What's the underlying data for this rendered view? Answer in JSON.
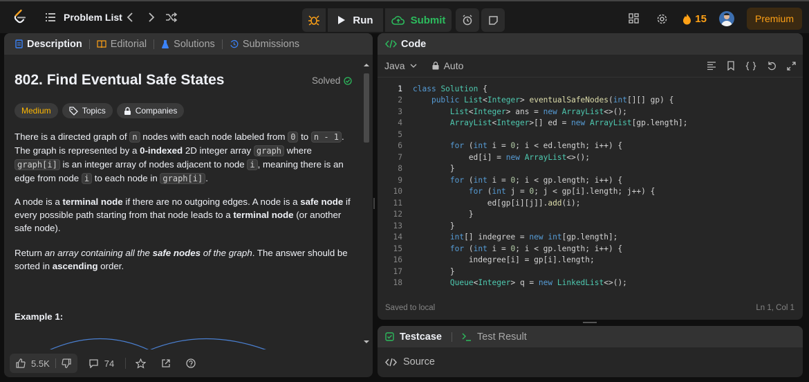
{
  "nav": {
    "problem_list": "Problem List"
  },
  "actions": {
    "run": "Run",
    "submit": "Submit"
  },
  "user": {
    "streak": "15",
    "premium": "Premium"
  },
  "left_tabs": [
    {
      "label": "Description"
    },
    {
      "label": "Editorial"
    },
    {
      "label": "Solutions"
    },
    {
      "label": "Submissions"
    }
  ],
  "problem": {
    "title": "802. Find Eventual Safe States",
    "status": "Solved",
    "difficulty": "Medium",
    "topics": "Topics",
    "companies": "Companies",
    "example_heading": "Example 1:"
  },
  "description": {
    "p1": {
      "t1": "There is a directed graph of ",
      "c1": "n",
      "t2": " nodes with each node labeled from ",
      "c2": "0",
      "t3": " to ",
      "c3": "n - 1",
      "t4": ". The graph is represented by a ",
      "b1": "0-indexed",
      "t5": " 2D integer array ",
      "c4": "graph",
      "t6": " where ",
      "c5": "graph[i]",
      "t7": " is an integer array of nodes adjacent to node ",
      "c6": "i",
      "t8": ", meaning there is an edge from node ",
      "c7": "i",
      "t9": " to each node in ",
      "c8": "graph[i]",
      "t10": "."
    },
    "p2": {
      "t1": "A node is a ",
      "b1": "terminal node",
      "t2": " if there are no outgoing edges. A node is a ",
      "b2": "safe node",
      "t3": " if every possible path starting from that node leads to a ",
      "b3": "terminal node",
      "t4": " (or another safe node)."
    },
    "p3": {
      "t1": "Return ",
      "i1": "an array containing all the ",
      "bi": "safe nodes",
      "i2": " of the graph",
      "t2": ". The answer should be sorted in ",
      "b1": "ascending",
      "t3": " order."
    }
  },
  "footer": {
    "likes": "5.5K",
    "comments": "74"
  },
  "code_panel": {
    "tab": "Code",
    "language": "Java",
    "mode": "Auto",
    "saved": "Saved to local",
    "cursor": "Ln 1, Col 1"
  },
  "code_lines": [
    {
      "n": "1"
    },
    {
      "n": "2"
    },
    {
      "n": "3"
    },
    {
      "n": "4"
    },
    {
      "n": "5"
    },
    {
      "n": "6"
    },
    {
      "n": "7"
    },
    {
      "n": "8"
    },
    {
      "n": "9"
    },
    {
      "n": "10"
    },
    {
      "n": "11"
    },
    {
      "n": "12"
    },
    {
      "n": "13"
    },
    {
      "n": "14"
    },
    {
      "n": "15"
    },
    {
      "n": "16"
    },
    {
      "n": "17"
    },
    {
      "n": "18"
    }
  ],
  "code_text": [
    "class Solution {",
    "    public List<Integer> eventualSafeNodes(int[][] gp) {",
    "        List<Integer> ans = new ArrayList<>();",
    "        ArrayList<Integer>[] ed = new ArrayList[gp.length];",
    "",
    "        for (int i = 0; i < ed.length; i++) {",
    "            ed[i] = new ArrayList<>();",
    "        }",
    "        for (int i = 0; i < gp.length; i++) {",
    "            for (int j = 0; j < gp[i].length; j++) {",
    "                ed[gp[i][j]].add(i);",
    "            }",
    "        }",
    "        int[] indegree = new int[gp.length];",
    "        for (int i = 0; i < gp.length; i++) {",
    "            indegree[i] = gp[i].length;",
    "        }",
    "        Queue<Integer> q = new LinkedList<>();"
  ],
  "test_panel": {
    "testcase": "Testcase",
    "test_result": "Test Result",
    "source": "Source"
  },
  "colors": {
    "accent": "#ffa116",
    "success": "#2cbb5d",
    "medium": "#ffb800"
  }
}
